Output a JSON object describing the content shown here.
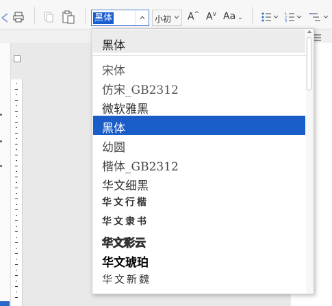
{
  "toolbar": {
    "font_name_value": "黑体",
    "font_size_value": "小初",
    "increase_font_label": "A",
    "decrease_font_label": "A",
    "change_case_label": "Aa"
  },
  "font_dropdown": {
    "current_font": "黑体",
    "items": [
      {
        "label": "宋体"
      },
      {
        "label": "仿宋_GB2312"
      },
      {
        "label": "微软雅黑"
      },
      {
        "label": "黑体"
      },
      {
        "label": "幼圆"
      },
      {
        "label": "楷体_GB2312"
      },
      {
        "label": "华文细黑"
      },
      {
        "label": "华文行楷"
      },
      {
        "label": "华文隶书"
      },
      {
        "label": "华文彩云"
      },
      {
        "label": "华文琥珀"
      },
      {
        "label": "华文新魏"
      }
    ],
    "selected_index": 3
  },
  "colors": {
    "selection_blue": "#1a5cc8",
    "input_highlight": "#1a5dd0",
    "toolbar_bg": "#f7f7f7"
  }
}
